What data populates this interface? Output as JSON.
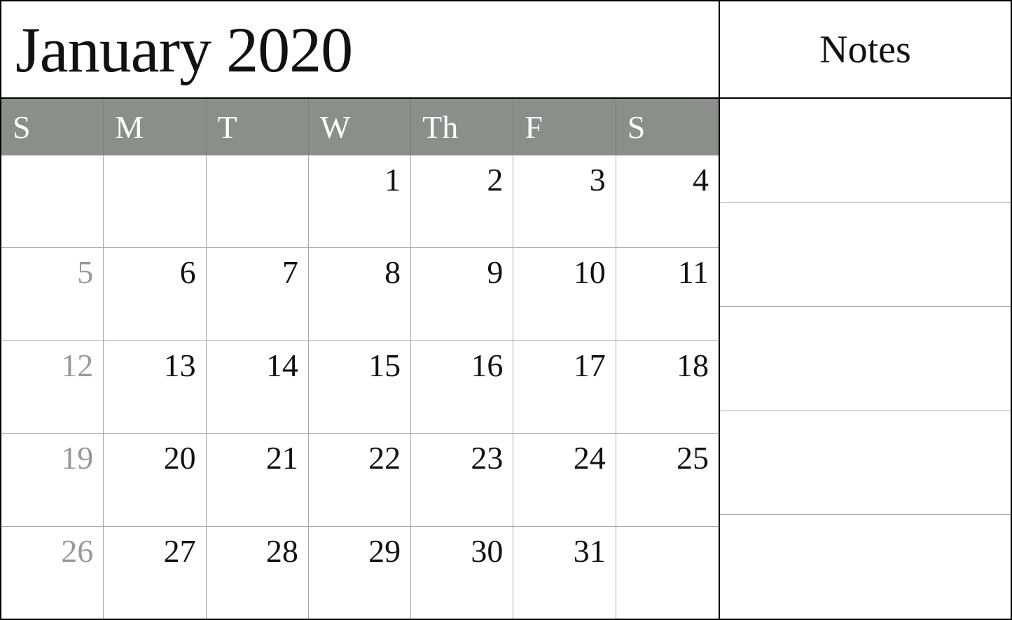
{
  "header": {
    "title": "January 2020",
    "notes_label": "Notes"
  },
  "day_headers": [
    "S",
    "M",
    "T",
    "W",
    "Th",
    "F",
    "S"
  ],
  "weeks": [
    [
      {
        "date": "",
        "empty": true
      },
      {
        "date": "",
        "empty": true
      },
      {
        "date": "",
        "empty": true
      },
      {
        "date": "1",
        "empty": false
      },
      {
        "date": "2",
        "empty": false
      },
      {
        "date": "3",
        "empty": false
      },
      {
        "date": "4",
        "empty": false
      }
    ],
    [
      {
        "date": "5",
        "empty": false,
        "sunday": true
      },
      {
        "date": "6",
        "empty": false
      },
      {
        "date": "7",
        "empty": false
      },
      {
        "date": "8",
        "empty": false
      },
      {
        "date": "9",
        "empty": false
      },
      {
        "date": "10",
        "empty": false
      },
      {
        "date": "11",
        "empty": false
      }
    ],
    [
      {
        "date": "12",
        "empty": false,
        "sunday": true
      },
      {
        "date": "13",
        "empty": false
      },
      {
        "date": "14",
        "empty": false
      },
      {
        "date": "15",
        "empty": false
      },
      {
        "date": "16",
        "empty": false
      },
      {
        "date": "17",
        "empty": false
      },
      {
        "date": "18",
        "empty": false
      }
    ],
    [
      {
        "date": "19",
        "empty": false,
        "sunday": true
      },
      {
        "date": "20",
        "empty": false
      },
      {
        "date": "21",
        "empty": false
      },
      {
        "date": "22",
        "empty": false
      },
      {
        "date": "23",
        "empty": false
      },
      {
        "date": "24",
        "empty": false
      },
      {
        "date": "25",
        "empty": false
      }
    ],
    [
      {
        "date": "26",
        "empty": false,
        "sunday": true
      },
      {
        "date": "27",
        "empty": false
      },
      {
        "date": "28",
        "empty": false
      },
      {
        "date": "29",
        "empty": false
      },
      {
        "date": "30",
        "empty": false
      },
      {
        "date": "31",
        "empty": false
      },
      {
        "date": "",
        "empty": true
      }
    ]
  ]
}
